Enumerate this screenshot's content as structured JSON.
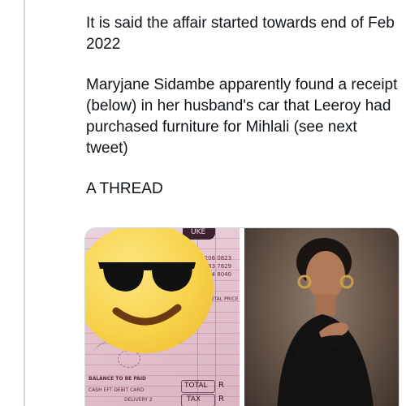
{
  "tweet": {
    "paragraphs": [
      "It is said the affair started towards end of Feb 2022",
      "Maryjane Sidambe apparently found a receipt (below) in her husband's car that Leeroy had purchased furniture for Mihlali (see next tweet)",
      "A THREAD"
    ]
  },
  "media": {
    "receipt": {
      "header_fragment": "UKE",
      "phone_lines": [
        "1 206 0823",
        "1 083 7629",
        "1 664 8040"
      ],
      "price_header": "TOTAL PRICE",
      "balance_label": "BALANCE TO BE PAID",
      "payment_options": "CASH  EFT  DEBIT CARD",
      "total_label": "TOTAL",
      "total_symbol": "R",
      "tax_label": "TAX",
      "tax_symbol": "R",
      "deliver_label": "DELIVERY 2"
    },
    "emoji_name": "smiling-face-with-sunglasses-icon",
    "photo_alt": "woman-portrait"
  },
  "colors": {
    "text": "#0f1419",
    "thread_line": "#cfd9de",
    "emoji_yellow": "#f7d24a",
    "receipt_pink": "#e4c3cf"
  }
}
